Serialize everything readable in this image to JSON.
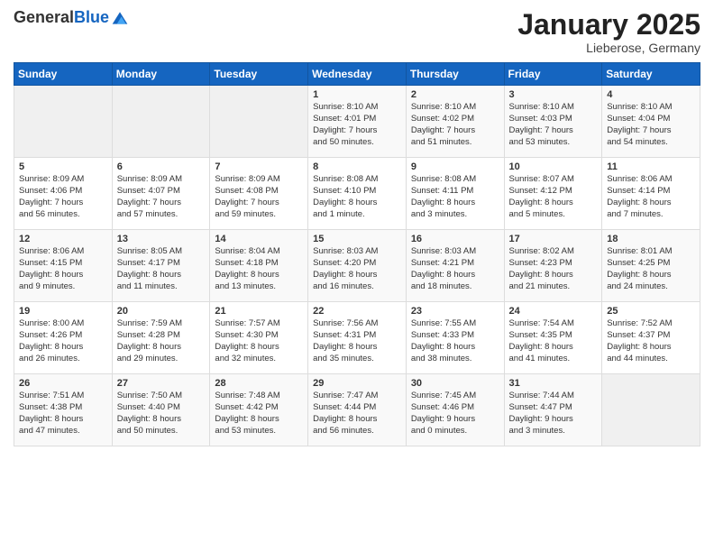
{
  "logo": {
    "general": "General",
    "blue": "Blue"
  },
  "header": {
    "month": "January 2025",
    "location": "Lieberose, Germany"
  },
  "weekdays": [
    "Sunday",
    "Monday",
    "Tuesday",
    "Wednesday",
    "Thursday",
    "Friday",
    "Saturday"
  ],
  "weeks": [
    [
      {
        "day": "",
        "info": ""
      },
      {
        "day": "",
        "info": ""
      },
      {
        "day": "",
        "info": ""
      },
      {
        "day": "1",
        "info": "Sunrise: 8:10 AM\nSunset: 4:01 PM\nDaylight: 7 hours\nand 50 minutes."
      },
      {
        "day": "2",
        "info": "Sunrise: 8:10 AM\nSunset: 4:02 PM\nDaylight: 7 hours\nand 51 minutes."
      },
      {
        "day": "3",
        "info": "Sunrise: 8:10 AM\nSunset: 4:03 PM\nDaylight: 7 hours\nand 53 minutes."
      },
      {
        "day": "4",
        "info": "Sunrise: 8:10 AM\nSunset: 4:04 PM\nDaylight: 7 hours\nand 54 minutes."
      }
    ],
    [
      {
        "day": "5",
        "info": "Sunrise: 8:09 AM\nSunset: 4:06 PM\nDaylight: 7 hours\nand 56 minutes."
      },
      {
        "day": "6",
        "info": "Sunrise: 8:09 AM\nSunset: 4:07 PM\nDaylight: 7 hours\nand 57 minutes."
      },
      {
        "day": "7",
        "info": "Sunrise: 8:09 AM\nSunset: 4:08 PM\nDaylight: 7 hours\nand 59 minutes."
      },
      {
        "day": "8",
        "info": "Sunrise: 8:08 AM\nSunset: 4:10 PM\nDaylight: 8 hours\nand 1 minute."
      },
      {
        "day": "9",
        "info": "Sunrise: 8:08 AM\nSunset: 4:11 PM\nDaylight: 8 hours\nand 3 minutes."
      },
      {
        "day": "10",
        "info": "Sunrise: 8:07 AM\nSunset: 4:12 PM\nDaylight: 8 hours\nand 5 minutes."
      },
      {
        "day": "11",
        "info": "Sunrise: 8:06 AM\nSunset: 4:14 PM\nDaylight: 8 hours\nand 7 minutes."
      }
    ],
    [
      {
        "day": "12",
        "info": "Sunrise: 8:06 AM\nSunset: 4:15 PM\nDaylight: 8 hours\nand 9 minutes."
      },
      {
        "day": "13",
        "info": "Sunrise: 8:05 AM\nSunset: 4:17 PM\nDaylight: 8 hours\nand 11 minutes."
      },
      {
        "day": "14",
        "info": "Sunrise: 8:04 AM\nSunset: 4:18 PM\nDaylight: 8 hours\nand 13 minutes."
      },
      {
        "day": "15",
        "info": "Sunrise: 8:03 AM\nSunset: 4:20 PM\nDaylight: 8 hours\nand 16 minutes."
      },
      {
        "day": "16",
        "info": "Sunrise: 8:03 AM\nSunset: 4:21 PM\nDaylight: 8 hours\nand 18 minutes."
      },
      {
        "day": "17",
        "info": "Sunrise: 8:02 AM\nSunset: 4:23 PM\nDaylight: 8 hours\nand 21 minutes."
      },
      {
        "day": "18",
        "info": "Sunrise: 8:01 AM\nSunset: 4:25 PM\nDaylight: 8 hours\nand 24 minutes."
      }
    ],
    [
      {
        "day": "19",
        "info": "Sunrise: 8:00 AM\nSunset: 4:26 PM\nDaylight: 8 hours\nand 26 minutes."
      },
      {
        "day": "20",
        "info": "Sunrise: 7:59 AM\nSunset: 4:28 PM\nDaylight: 8 hours\nand 29 minutes."
      },
      {
        "day": "21",
        "info": "Sunrise: 7:57 AM\nSunset: 4:30 PM\nDaylight: 8 hours\nand 32 minutes."
      },
      {
        "day": "22",
        "info": "Sunrise: 7:56 AM\nSunset: 4:31 PM\nDaylight: 8 hours\nand 35 minutes."
      },
      {
        "day": "23",
        "info": "Sunrise: 7:55 AM\nSunset: 4:33 PM\nDaylight: 8 hours\nand 38 minutes."
      },
      {
        "day": "24",
        "info": "Sunrise: 7:54 AM\nSunset: 4:35 PM\nDaylight: 8 hours\nand 41 minutes."
      },
      {
        "day": "25",
        "info": "Sunrise: 7:52 AM\nSunset: 4:37 PM\nDaylight: 8 hours\nand 44 minutes."
      }
    ],
    [
      {
        "day": "26",
        "info": "Sunrise: 7:51 AM\nSunset: 4:38 PM\nDaylight: 8 hours\nand 47 minutes."
      },
      {
        "day": "27",
        "info": "Sunrise: 7:50 AM\nSunset: 4:40 PM\nDaylight: 8 hours\nand 50 minutes."
      },
      {
        "day": "28",
        "info": "Sunrise: 7:48 AM\nSunset: 4:42 PM\nDaylight: 8 hours\nand 53 minutes."
      },
      {
        "day": "29",
        "info": "Sunrise: 7:47 AM\nSunset: 4:44 PM\nDaylight: 8 hours\nand 56 minutes."
      },
      {
        "day": "30",
        "info": "Sunrise: 7:45 AM\nSunset: 4:46 PM\nDaylight: 9 hours\nand 0 minutes."
      },
      {
        "day": "31",
        "info": "Sunrise: 7:44 AM\nSunset: 4:47 PM\nDaylight: 9 hours\nand 3 minutes."
      },
      {
        "day": "",
        "info": ""
      }
    ]
  ]
}
